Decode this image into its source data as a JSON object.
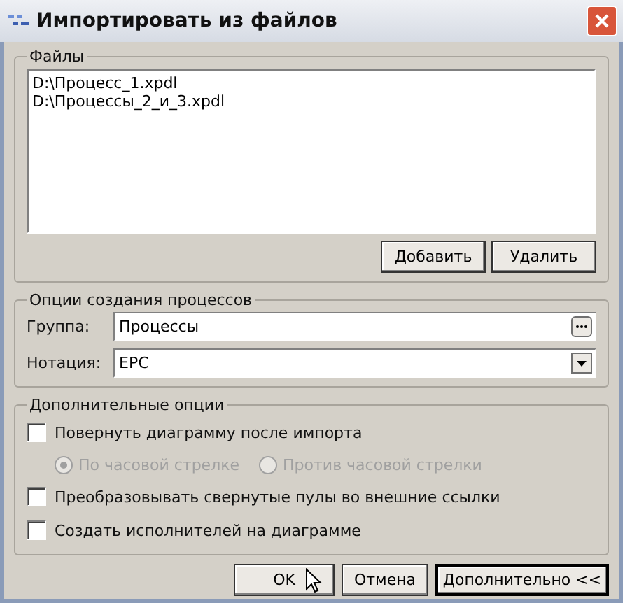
{
  "window": {
    "title": "Импортировать из файлов"
  },
  "files": {
    "legend": "Файлы",
    "items": [
      "D:\\Процесс_1.xpdl",
      "D:\\Процессы_2_и_3.xpdl"
    ],
    "buttons": [
      "Добавить",
      "Удалить"
    ]
  },
  "process_options": {
    "legend": "Опции создания процессов",
    "group": {
      "label": "Группа:",
      "value": "Процессы"
    },
    "notation": {
      "label": "Нотация:",
      "value": "EPC"
    }
  },
  "extra_options": {
    "legend": "Дополнительные опции",
    "rotate": {
      "label": "Повернуть диаграмму после импорта",
      "checked": false
    },
    "directions": [
      {
        "label": "По часовой стрелке",
        "selected": true,
        "disabled": true
      },
      {
        "label": "Против часовой стрелки",
        "selected": false,
        "disabled": true
      }
    ],
    "options": [
      {
        "label": "Преобразовывать свернутые пулы во внешние ссылки",
        "checked": false
      },
      {
        "label": "Создать исполнителей на диаграмме",
        "checked": false
      }
    ]
  },
  "buttons": [
    {
      "label": "OK",
      "default": false
    },
    {
      "label": "Отмена",
      "default": false
    },
    {
      "label": "Дополнительно <<",
      "default": true
    }
  ]
}
